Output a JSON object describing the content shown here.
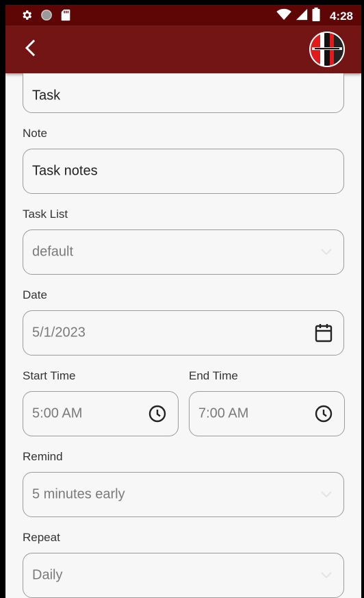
{
  "status_bar": {
    "time": "4:28",
    "left_icons": [
      "gear-icon",
      "record-icon",
      "sd-card-icon"
    ],
    "right_icons": [
      "wifi-icon",
      "cellular-signal-icon",
      "battery-icon"
    ]
  },
  "app_bar": {
    "back_icon": "chevron-left-icon",
    "avatar_icon": "app-logo-avatar",
    "colors": {
      "background": "#731515",
      "status_bar": "#5e0606"
    }
  },
  "form": {
    "title_field": {
      "value": "Task"
    },
    "note": {
      "label": "Note",
      "value": "Task notes"
    },
    "task_list": {
      "label": "Task List",
      "selected": "default"
    },
    "date": {
      "label": "Date",
      "value": "5/1/2023"
    },
    "start_time": {
      "label": "Start Time",
      "value": "5:00 AM"
    },
    "end_time": {
      "label": "End Time",
      "value": "7:00 AM"
    },
    "remind": {
      "label": "Remind",
      "selected": "5 minutes early"
    },
    "repeat": {
      "label": "Repeat",
      "selected": "Daily"
    }
  }
}
